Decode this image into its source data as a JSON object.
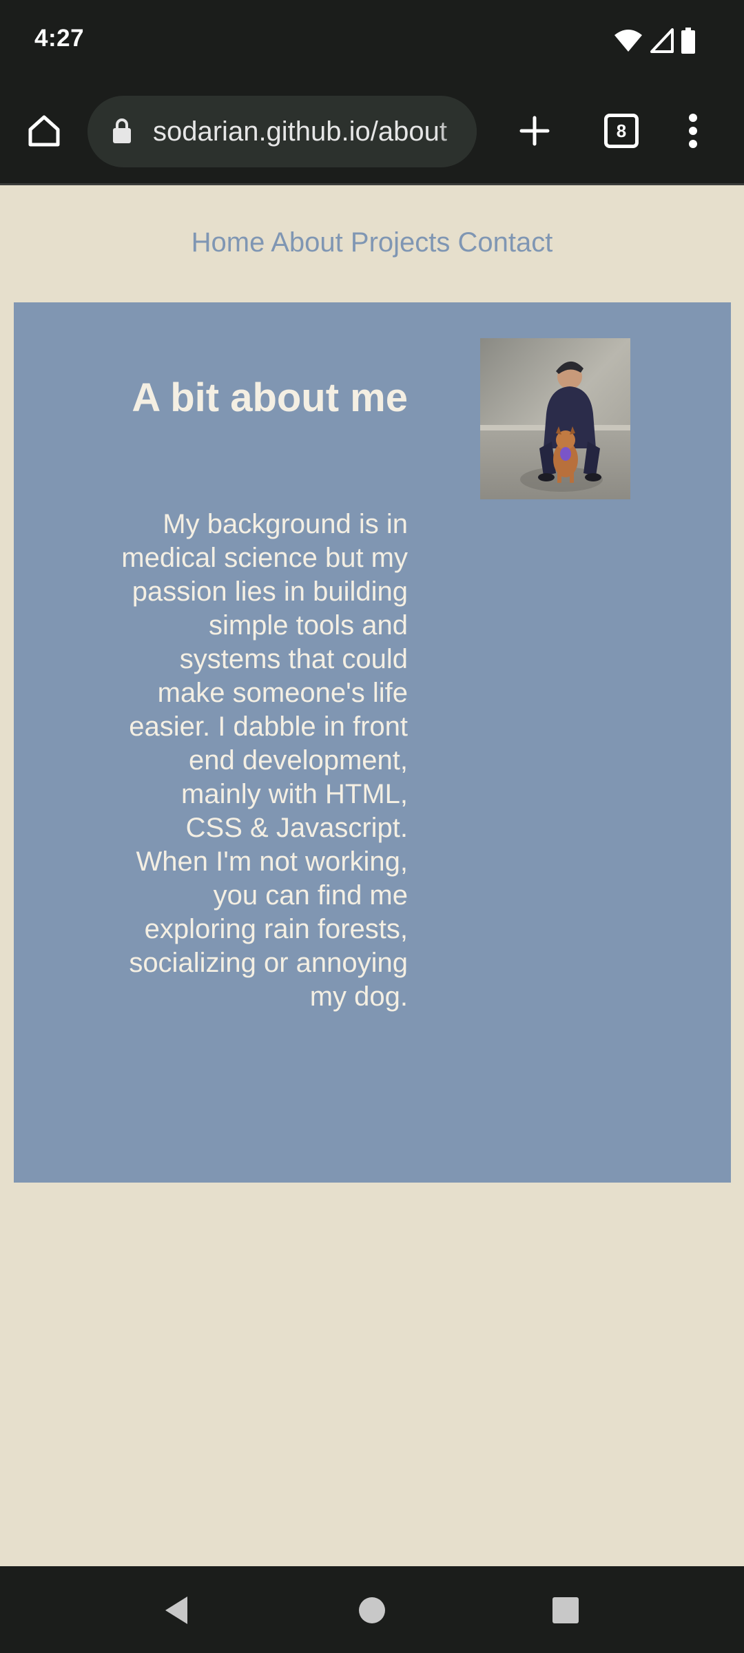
{
  "status_bar": {
    "time": "4:27",
    "icons": [
      "wifi-icon",
      "cellular-signal-icon",
      "battery-icon"
    ]
  },
  "browser": {
    "url": "sodarian.github.io/about",
    "tab_count": "8",
    "icons": [
      "home-icon",
      "lock-icon",
      "plus-icon",
      "tab-switcher-icon",
      "more-vert-icon"
    ]
  },
  "site": {
    "nav": [
      "Home",
      "About",
      "Projects",
      "Contact"
    ],
    "heading": "A bit about me",
    "body": "My background is in medical science but my passion lies in building simple tools and systems that could make someone's life easier. I dabble in front end development, mainly with HTML, CSS & Javascript. When I'm not working, you can find me exploring rain forests, socializing or annoying my dog.",
    "photo": "profile-photo-person-with-dog"
  },
  "system_nav": {
    "icons": [
      "back-icon",
      "home-circle-icon",
      "recents-square-icon"
    ]
  },
  "colors": {
    "page_background": "#e6dfcc",
    "card_background": "#8096b2",
    "nav_link": "#7f96b3",
    "card_text": "#f4efe3",
    "chrome_dark": "#1b1d1b"
  }
}
